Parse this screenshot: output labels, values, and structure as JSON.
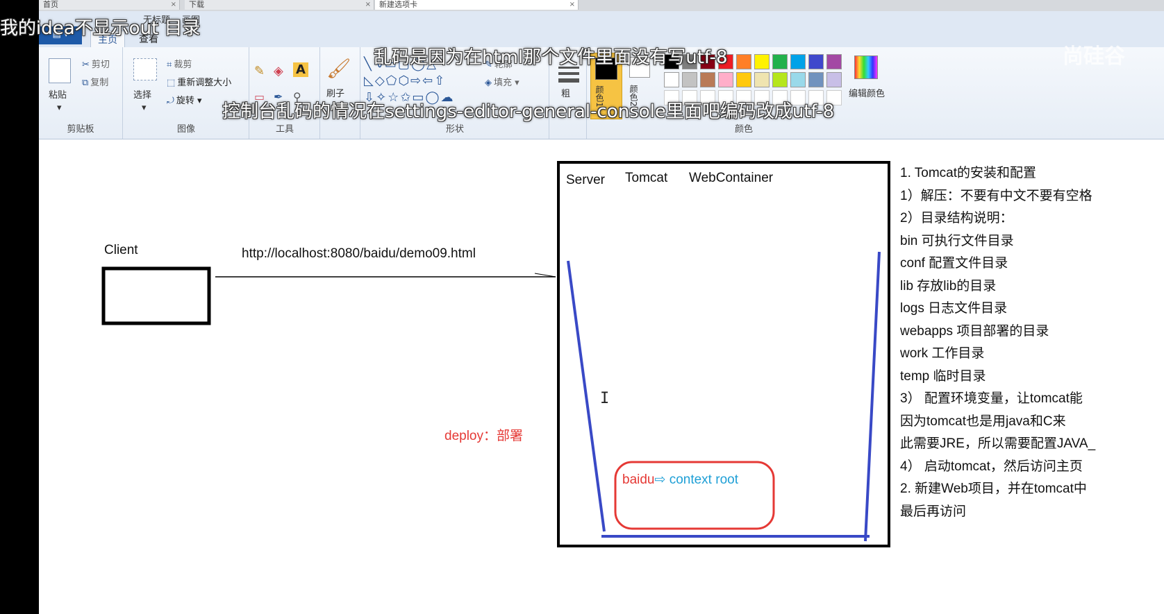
{
  "window": {
    "tabs": [
      {
        "label": "首页"
      },
      {
        "label": "下载"
      },
      {
        "label": "新建选项卡"
      }
    ]
  },
  "ribbon": {
    "file_button": "▤ ▾",
    "tabs": [
      "主页",
      "查看"
    ],
    "quick_labels": [
      "无标题",
      "画图"
    ],
    "clipboard": {
      "paste": "粘贴",
      "cut": "剪切",
      "copy": "复制",
      "label": "剪贴板"
    },
    "image": {
      "select": "选择",
      "crop": "裁剪",
      "resize": "重新调整大小",
      "rotate": "旋转",
      "label": "图像"
    },
    "tools": {
      "label": "工具"
    },
    "brush": {
      "label": "刷子"
    },
    "shapes": {
      "outline": "轮廓",
      "fill": "填充",
      "label": "形状"
    },
    "size": {
      "label": "粗"
    },
    "colors": {
      "color1": "颜色1",
      "color2": "颜色2",
      "edit": "编辑颜色",
      "label": "颜色",
      "row1": [
        "#000000",
        "#7f7f7f",
        "#880015",
        "#ed1c24",
        "#ff7f27",
        "#fff200",
        "#22b14c",
        "#00a2e8",
        "#3f48cc",
        "#a349a4"
      ],
      "row2": [
        "#ffffff",
        "#c3c3c3",
        "#b97a57",
        "#ffaec9",
        "#ffc90e",
        "#efe4b0",
        "#b5e61d",
        "#99d9ea",
        "#7092be",
        "#c8bfe7"
      ]
    }
  },
  "overlay": {
    "top_left": "我的idea不显示out 目录",
    "line1": "乱码是因为在html那个文件里面没有写utf-8",
    "line2": "控制台乱码的情况在settings-editor-general-console里面吧编码改成utf-8",
    "watermark": "尚硅谷"
  },
  "diagram": {
    "client_label": "Client",
    "url": "http://localhost:8080/baidu/demo09.html",
    "deploy": "deploy：部署",
    "server_labels": [
      "Server",
      "Tomcat",
      "WebContainer"
    ],
    "context_app": "baidu",
    "context_arrow": "⇨",
    "context_root": "context root",
    "colors": {
      "red": "#e53935",
      "blue": "#3949c6",
      "cyan": "#1e9fd6",
      "black": "#000000"
    }
  },
  "notes": [
    "1. Tomcat的安装和配置",
    "1）解压：不要有中文不要有空格",
    "2）目录结构说明：",
    "    bin  可执行文件目录",
    "    conf  配置文件目录",
    "    lib    存放lib的目录",
    "    logs   日志文件目录",
    "    webapps   项目部署的目录",
    "    work   工作目录",
    "    temp 临时目录",
    "3） 配置环境变量，让tomcat能",
    "   因为tomcat也是用java和C来",
    "此需要JRE，所以需要配置JAVA_",
    "4） 启动tomcat，然后访问主页",
    "2. 新建Web项目，并在tomcat中",
    "最后再访问"
  ]
}
